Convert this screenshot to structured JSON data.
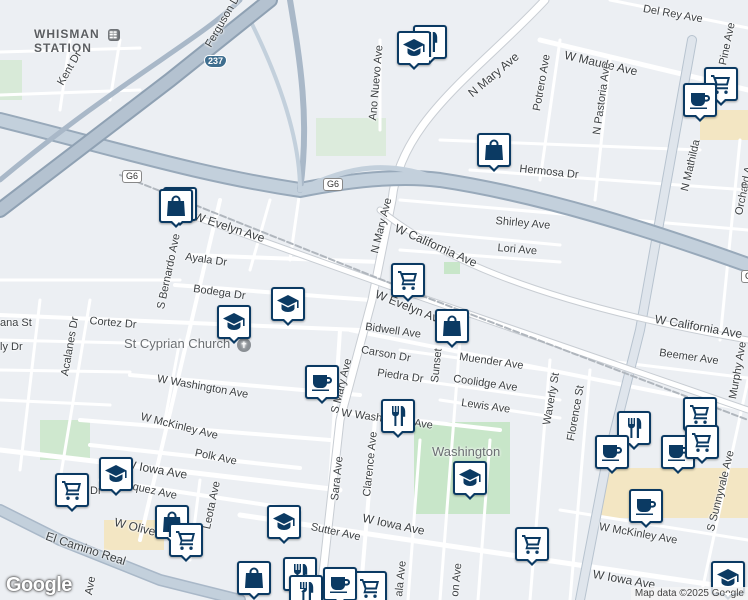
{
  "map": {
    "attribution": "Map data ©2025 Google",
    "logo": "Google",
    "station_label_1": "WHISMAN",
    "station_label_2": "STATION",
    "station_icon": "transit-icon",
    "colors": {
      "background": "#eceff3",
      "road": "#ffffff",
      "highway": "#a9b8c8",
      "park": "#c8e6c9",
      "marker_border": "#0b3a63",
      "marker_icon": "#0b3a63"
    }
  },
  "street_labels": [
    {
      "text": "Del Rey Ave"
    },
    {
      "text": "W Maude Ave"
    },
    {
      "text": "Potrero Ave"
    },
    {
      "text": "N Mary Ave"
    },
    {
      "text": "Ano Nuevo Ave"
    },
    {
      "text": "Ferguson Dr"
    },
    {
      "text": "Kent Dr"
    },
    {
      "text": "N Pastoria Ave"
    },
    {
      "text": "N Mathilda"
    },
    {
      "text": "Pine Ave"
    },
    {
      "text": "Hermosa Dr"
    },
    {
      "text": "Orchard A"
    },
    {
      "text": "N Mary Ave"
    },
    {
      "text": "W California Ave"
    },
    {
      "text": "Shirley Ave"
    },
    {
      "text": "Lori Ave"
    },
    {
      "text": "W Evelyn Ave"
    },
    {
      "text": "S Bernardo Ave"
    },
    {
      "text": "Ayala Dr"
    },
    {
      "text": "Bodega Dr"
    },
    {
      "text": "Cortez Dr"
    },
    {
      "text": "ana St"
    },
    {
      "text": "ly Dr"
    },
    {
      "text": "Acalanes Dr"
    },
    {
      "text": "W Evelyn Ave"
    },
    {
      "text": "Bidwell Ave"
    },
    {
      "text": "Carson Dr"
    },
    {
      "text": "Piedra Dr"
    },
    {
      "text": "Sunset"
    },
    {
      "text": "Muender Ave"
    },
    {
      "text": "Coolidge Ave"
    },
    {
      "text": "Lewis Ave"
    },
    {
      "text": "W California Ave"
    },
    {
      "text": "Beemer Ave"
    },
    {
      "text": "Murphy Ave"
    },
    {
      "text": "W Washington Ave"
    },
    {
      "text": "S Mary Ave"
    },
    {
      "text": "W Washington Ave"
    },
    {
      "text": "Waverly St"
    },
    {
      "text": "Florence St"
    },
    {
      "text": "W McKinley Ave"
    },
    {
      "text": "Polk Ave"
    },
    {
      "text": "W Iowa Ave"
    },
    {
      "text": "Vasquez Ave"
    },
    {
      "text": "Dr"
    },
    {
      "text": "Leota Ave"
    },
    {
      "text": "W Olive"
    },
    {
      "text": "Sutter Ave"
    },
    {
      "text": "W Iowa Ave"
    },
    {
      "text": "El Camino Real"
    },
    {
      "text": "Sara Ave"
    },
    {
      "text": "Clarence Ave"
    },
    {
      "text": "W McKinley Ave"
    },
    {
      "text": "S Sunnyvale Ave"
    },
    {
      "text": "W Iowa Ave"
    },
    {
      "text": "Ave"
    },
    {
      "text": "ala Ave"
    },
    {
      "text": "on Ave"
    },
    {
      "text": "e"
    }
  ],
  "poi_labels": [
    {
      "text": "St Cyprian Church",
      "icon": "church-icon"
    },
    {
      "text": "Washington",
      "icon": ""
    }
  ],
  "route_shields": [
    {
      "text": "237"
    },
    {
      "text": "G6"
    },
    {
      "text": "G6"
    },
    {
      "text": "G6"
    }
  ],
  "markers": [
    {
      "type": "restaurant"
    },
    {
      "type": "grocery"
    },
    {
      "type": "cafe"
    },
    {
      "type": "shopping"
    },
    {
      "type": "restaurant"
    },
    {
      "type": "grocery"
    },
    {
      "type": "school"
    },
    {
      "type": "school"
    },
    {
      "type": "shopping"
    },
    {
      "type": "cafe"
    },
    {
      "type": "restaurant"
    },
    {
      "type": "school"
    },
    {
      "type": "restaurant"
    },
    {
      "type": "grocery"
    },
    {
      "type": "cafe"
    },
    {
      "type": "cafe"
    },
    {
      "type": "grocery"
    },
    {
      "type": "school"
    },
    {
      "type": "grocery"
    },
    {
      "type": "cafe"
    },
    {
      "type": "grocery"
    },
    {
      "type": "school"
    },
    {
      "type": "shopping"
    },
    {
      "type": "grocery"
    },
    {
      "type": "school"
    },
    {
      "type": "grocery"
    },
    {
      "type": "shopping"
    },
    {
      "type": "restaurant"
    },
    {
      "type": "restaurant"
    },
    {
      "type": "cafe"
    },
    {
      "type": "shopping"
    },
    {
      "type": "school"
    }
  ]
}
